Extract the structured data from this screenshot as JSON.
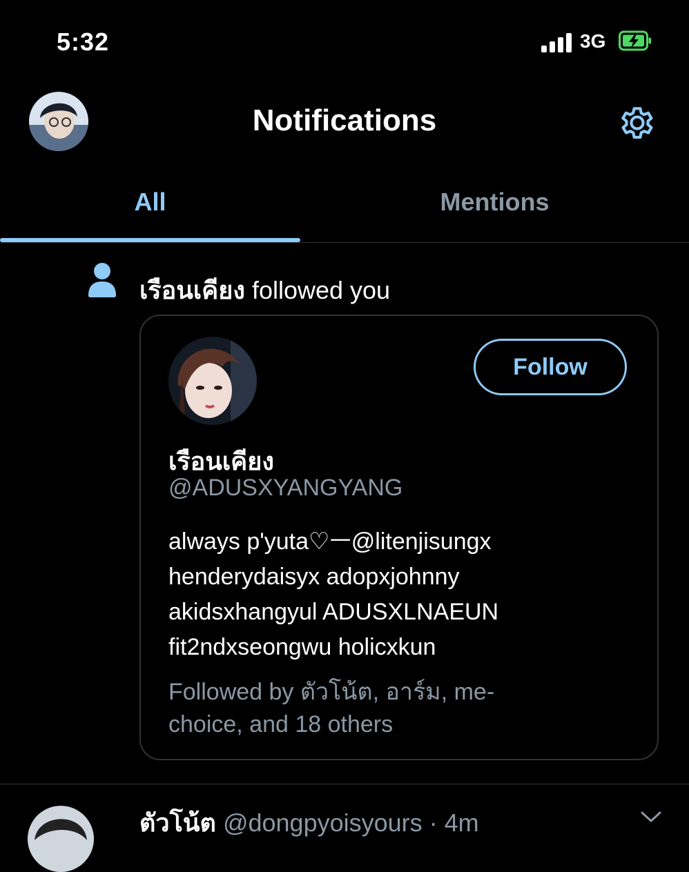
{
  "status_bar": {
    "time": "5:32",
    "network": "3G",
    "signal_icon": "cellular-signal-icon",
    "battery_icon": "battery-charging-icon",
    "battery_color": "#4cd964"
  },
  "header": {
    "title": "Notifications",
    "avatar": "profile-avatar",
    "settings_icon": "gear-icon"
  },
  "tabs": [
    {
      "label": "All",
      "active": true
    },
    {
      "label": "Mentions",
      "active": false
    }
  ],
  "notification": {
    "icon": "person-icon",
    "actor_name": "เรือนเคียง",
    "action_text": " followed you",
    "card": {
      "name": "เรือนเคียง",
      "handle": "@ADUSXYANGYANG",
      "bio": "always p'yuta♡ㅡ@litenjisungx\nhenderydaisyx adopxjohnny\nakidsxhangyul ADUSXLNAEUN\nfit2ndxseongwu holicxkun",
      "followed_by": "Followed by ตัวโน้ต, อาร์ม, me-\nchoice, and 18 others",
      "follow_label": "Follow"
    }
  },
  "next_item": {
    "name": "ตัวโน้ต",
    "handle_time": "@dongpyoisyours · 4m",
    "chevron_icon": "chevron-down-icon"
  },
  "colors": {
    "accent": "#8ecbf8",
    "secondary_text": "#8b98a5",
    "divider": "#2f3336",
    "background": "#000000"
  }
}
